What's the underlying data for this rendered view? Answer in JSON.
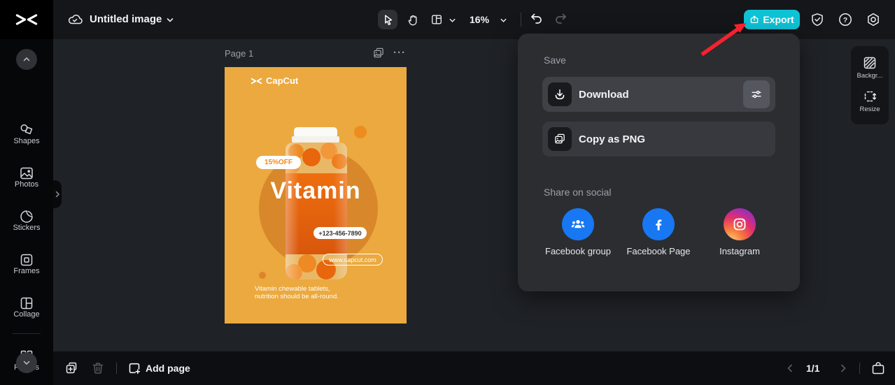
{
  "topbar": {
    "title": "Untitled image",
    "zoom": "16%",
    "export": "Export"
  },
  "sidebar": {
    "items": [
      {
        "label": "Shapes"
      },
      {
        "label": "Photos"
      },
      {
        "label": "Stickers"
      },
      {
        "label": "Frames"
      },
      {
        "label": "Collage"
      },
      {
        "label": "Plugins"
      }
    ]
  },
  "canvas": {
    "page_label": "Page 1"
  },
  "poster": {
    "brand": "CapCut",
    "badge": "15%OFF",
    "title": "Vitamin",
    "phone": "+123-456-7890",
    "website": "www.capcut.com",
    "desc1": "Vitamin chewable tablets,",
    "desc2": "nutrition should be all-round.",
    "colors": {
      "background": "#EBA93F",
      "circle": "#D8882A",
      "label": "#E8650D",
      "dot": "#ED8D1F"
    }
  },
  "export_popup": {
    "save": "Save",
    "download": "Download",
    "copy_png": "Copy as PNG",
    "share": "Share on social",
    "social": [
      {
        "label": "Facebook group"
      },
      {
        "label": "Facebook Page"
      },
      {
        "label": "Instagram"
      }
    ]
  },
  "right_panel": {
    "items": [
      {
        "label": "Backgr..."
      },
      {
        "label": "Resize"
      }
    ]
  },
  "bottom_bar": {
    "add_page": "Add page",
    "page_indicator": "1/1"
  },
  "colors": {
    "accent": "#0FC3D6",
    "facebook": "#1877F2",
    "arrow_red": "#F5222D"
  }
}
